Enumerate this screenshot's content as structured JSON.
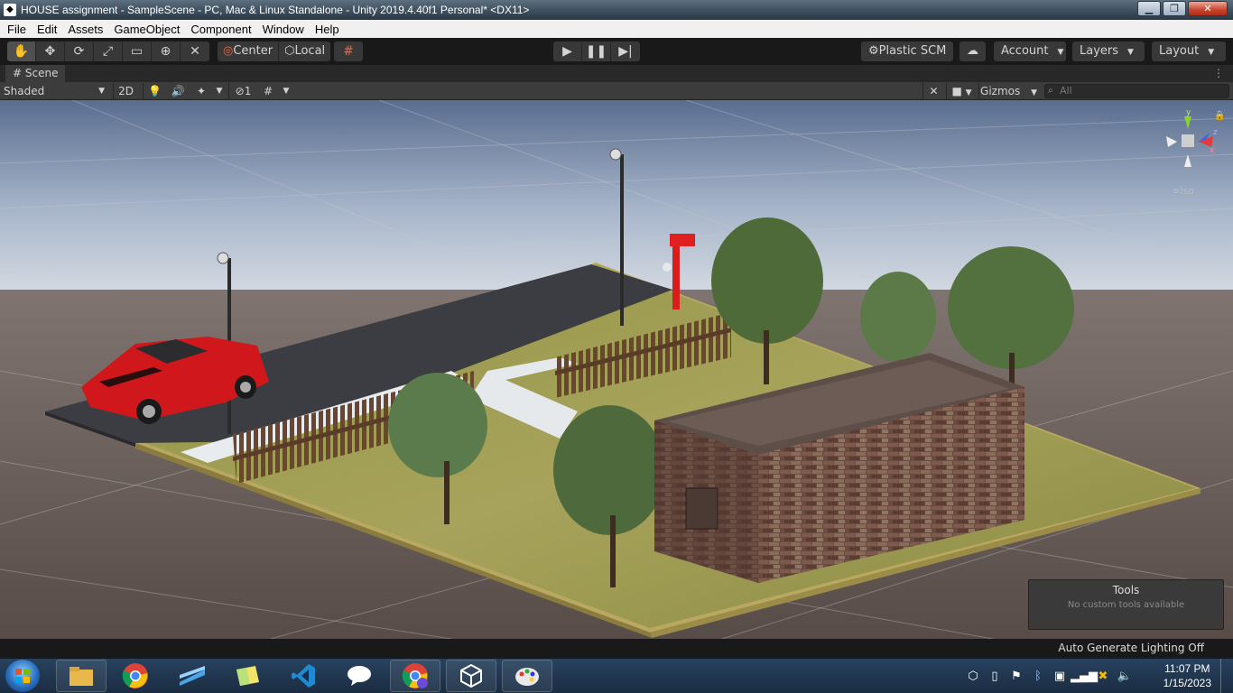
{
  "window": {
    "title": "HOUSE  assignment - SampleScene - PC, Mac & Linux Standalone - Unity 2019.4.40f1 Personal* <DX11>"
  },
  "menu": [
    "File",
    "Edit",
    "Assets",
    "GameObject",
    "Component",
    "Window",
    "Help"
  ],
  "toolbar": {
    "pivot_label": "Center",
    "space_label": "Local",
    "plastic_label": "Plastic SCM",
    "account_label": "Account",
    "layers_label": "Layers",
    "layout_label": "Layout"
  },
  "scene_tab": {
    "label": "Scene"
  },
  "scene_bar": {
    "shading": "Shaded",
    "mode_2d": "2D",
    "hidden_count": "1",
    "gizmos_label": "Gizmos",
    "search_placeholder": "All"
  },
  "gizmo": {
    "x": "x",
    "y": "y",
    "z": "z",
    "projection": "Iso"
  },
  "tools_panel": {
    "title": "Tools",
    "subtitle": "No custom tools available"
  },
  "status": {
    "message": "Auto Generate Lighting Off"
  },
  "taskbar": {
    "time": "11:07 PM",
    "date": "1/15/2023"
  }
}
